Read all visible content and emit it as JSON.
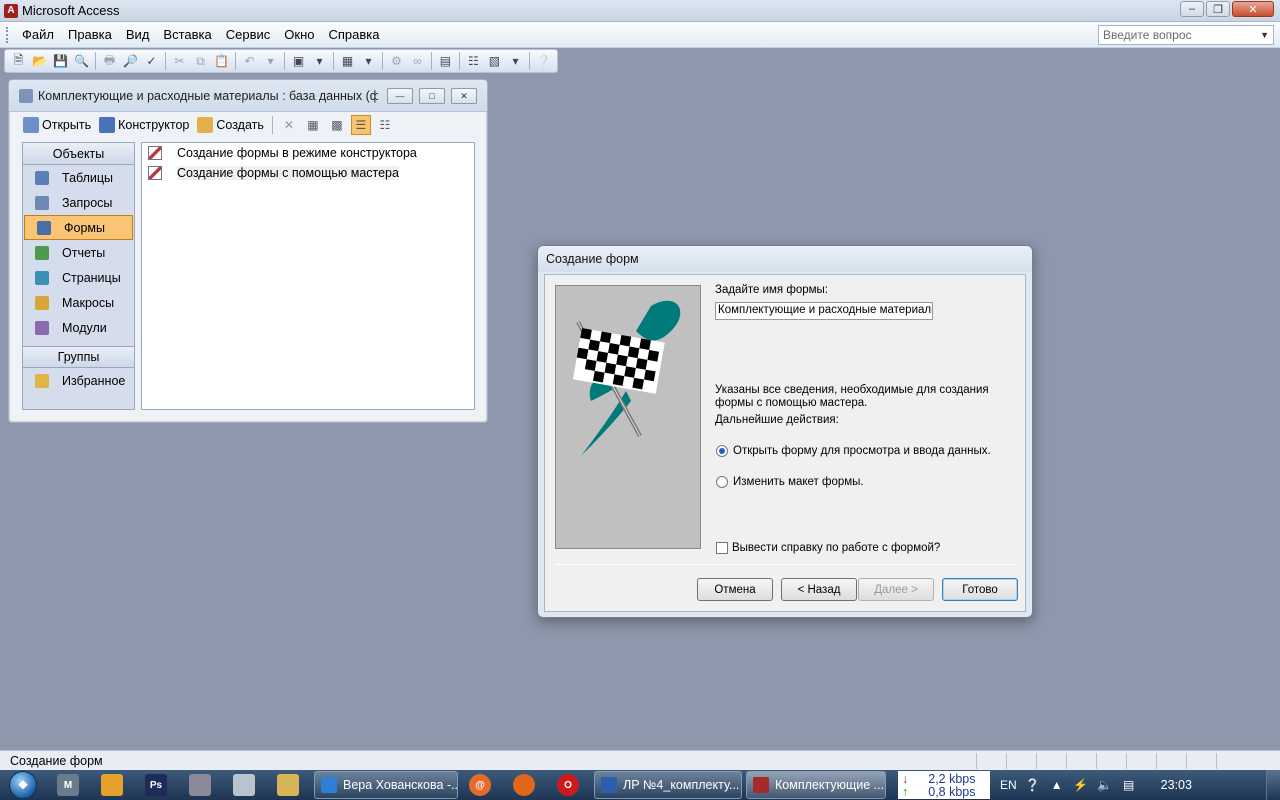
{
  "app": {
    "title": "Microsoft Access"
  },
  "menu": [
    {
      "label": "Файл"
    },
    {
      "label": "Правка"
    },
    {
      "label": "Вид"
    },
    {
      "label": "Вставка"
    },
    {
      "label": "Сервис"
    },
    {
      "label": "Окно"
    },
    {
      "label": "Справка"
    }
  ],
  "ask": {
    "placeholder": "Введите вопрос"
  },
  "dbwindow": {
    "title": "Комплектующие и расходные материалы : база данных (фо...",
    "tools": {
      "open": "Открыть",
      "design": "Конструктор",
      "create": "Создать"
    },
    "objects_header": "Объекты",
    "objects": [
      {
        "label": "Таблицы"
      },
      {
        "label": "Запросы"
      },
      {
        "label": "Формы"
      },
      {
        "label": "Отчеты"
      },
      {
        "label": "Страницы"
      },
      {
        "label": "Макросы"
      },
      {
        "label": "Модули"
      }
    ],
    "groups_header": "Группы",
    "groups": [
      {
        "label": "Избранное"
      }
    ],
    "list": [
      {
        "label": "Создание формы в режиме конструктора"
      },
      {
        "label": "Создание формы с помощью мастера"
      }
    ]
  },
  "wizard": {
    "title": "Создание форм",
    "name_prompt": "Задайте имя формы:",
    "name_value": "Комплектующие и расходные материалы",
    "info_line1": "Указаны все сведения, необходимые для создания",
    "info_line2": "формы с помощью мастера.",
    "next_prompt": "Дальнейшие действия:",
    "option_open": "Открыть форму для просмотра и ввода данных.",
    "option_modify": "Изменить макет формы.",
    "help_check": "Вывести справку по работе с формой?",
    "btn_cancel": "Отмена",
    "btn_back": "< Назад",
    "btn_next": "Далее >",
    "btn_finish": "Готово"
  },
  "status": {
    "text": "Создание форм"
  },
  "taskbar": {
    "tasks": [
      {
        "label": "Вера Хованскова -..."
      },
      {
        "label": "ЛР №4_комплекту..."
      },
      {
        "label": "Комплектующие ..."
      }
    ],
    "net_down": "2,2 kbps",
    "net_up": "0,8 kbps",
    "lang": "EN",
    "clock": "23:03"
  },
  "colors": {
    "selected": "#f9c474",
    "desktop": "#8f97ad",
    "flag_teal": "#007a7a"
  }
}
